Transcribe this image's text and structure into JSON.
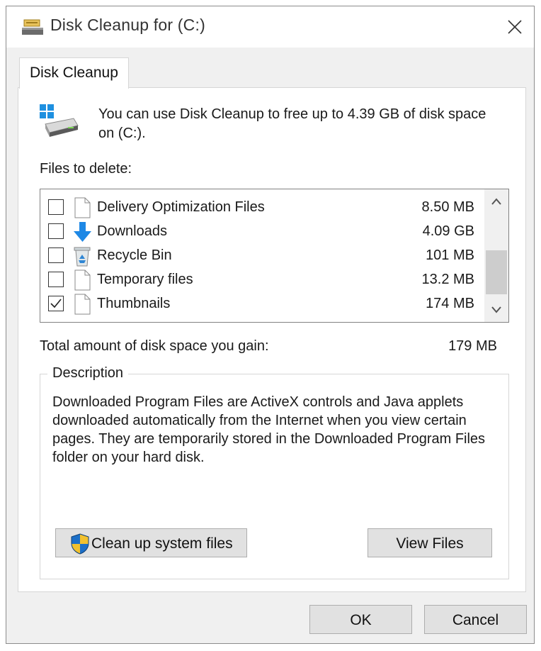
{
  "window": {
    "title": "Disk Cleanup for  (C:)",
    "close_icon": "close-icon"
  },
  "tab": {
    "label": "Disk Cleanup"
  },
  "intro": {
    "text": "You can use Disk Cleanup to free up to 4.39 GB of disk space on  (C:).",
    "icon": "drive-icon"
  },
  "files_label": "Files to delete:",
  "files": [
    {
      "name": "Delivery Optimization Files",
      "size": "8.50 MB",
      "checked": false,
      "icon": "file-icon"
    },
    {
      "name": "Downloads",
      "size": "4.09 GB",
      "checked": false,
      "icon": "download-arrow-icon"
    },
    {
      "name": "Recycle Bin",
      "size": "101 MB",
      "checked": false,
      "icon": "recycle-bin-icon"
    },
    {
      "name": "Temporary files",
      "size": "13.2 MB",
      "checked": false,
      "icon": "file-icon"
    },
    {
      "name": "Thumbnails",
      "size": "174 MB",
      "checked": true,
      "icon": "file-icon"
    }
  ],
  "total": {
    "label": "Total amount of disk space you gain:",
    "value": "179 MB"
  },
  "description": {
    "legend": "Description",
    "text": "Downloaded Program Files are ActiveX controls and Java applets downloaded automatically from the Internet when you view certain pages. They are temporarily stored in the Downloaded Program Files folder on your hard disk."
  },
  "buttons": {
    "cleanup_system": "Clean up system files",
    "view_files": "View Files",
    "ok": "OK",
    "cancel": "Cancel"
  },
  "colors": {
    "accent_blue": "#1e88e5",
    "window_bg": "#f0f0f0",
    "button_bg": "#e1e1e1"
  }
}
